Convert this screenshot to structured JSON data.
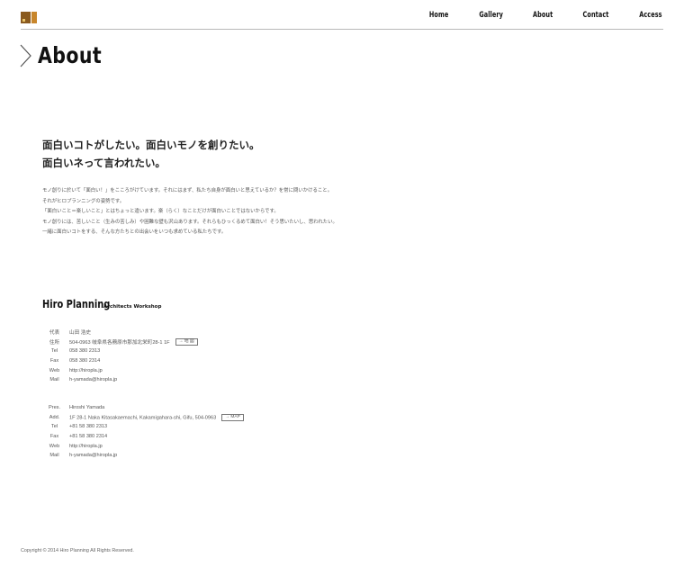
{
  "header": {
    "logo": "logo-icon",
    "nav": [
      "Home",
      "Gallery",
      "About",
      "Contact",
      "Access"
    ]
  },
  "page": {
    "title": "About",
    "title_icon": "chevron-right-icon"
  },
  "lead": [
    "面白いコトがしたい。面白いモノを創りたい。",
    "面白いネって言われたい。"
  ],
  "body": [
    "モノ創りに於いて「面白い！」をこころがけています。それにはまず、私たち自身が面白いと思えているか？を常に問いかけること。",
    "それがヒロプランニングの姿勢です。",
    "「面白いこと＝楽しいこと」とはちょっと違います。楽（らく）なことだけが面白いことではないからです。",
    "モノ創りには、苦しいこと（生みの苦しみ）や困難な壁も沢山あります。それらもひっくるめて面白い！そう思いたいし、思われたい。",
    "一緒に面白いコトをする、そんな方たちとの出会いをいつも求めている私たちです。"
  ],
  "company": {
    "name": "Hiro Planning",
    "subtitle": "Architects Workshop"
  },
  "info_jp": [
    {
      "label": "代表",
      "value": "山田 浩史"
    },
    {
      "label": "住所",
      "value": "504-0963 岐阜県各務原市那加北栄町28-1 1F",
      "button": "→ 地 図"
    },
    {
      "label": "Tel",
      "value": "058 380 2313"
    },
    {
      "label": "Fax",
      "value": "058 380 2314"
    },
    {
      "label": "Web",
      "value": "http://hiropla.jp"
    },
    {
      "label": "Mail",
      "value": "h-yamada@hiropla.jp"
    }
  ],
  "info_en": [
    {
      "label": "Pres.",
      "value": "Hiroshi Yamada"
    },
    {
      "label": "Add.",
      "value": "1F 28-1 Naka Kitasakaemachi, Kakamigahara-shi, Gifu, 504-0963",
      "button": "→ MAP"
    },
    {
      "label": "Tel",
      "value": "+81 58 380 2313"
    },
    {
      "label": "Fax",
      "value": "+81 58 380 2314"
    },
    {
      "label": "Web",
      "value": "http://hiropla.jp"
    },
    {
      "label": "Mail",
      "value": "h-yamada@hiropla.jp"
    }
  ],
  "footer": {
    "copyright": "Copyright © 2014 Hiro Planning All Rights Reserved."
  }
}
